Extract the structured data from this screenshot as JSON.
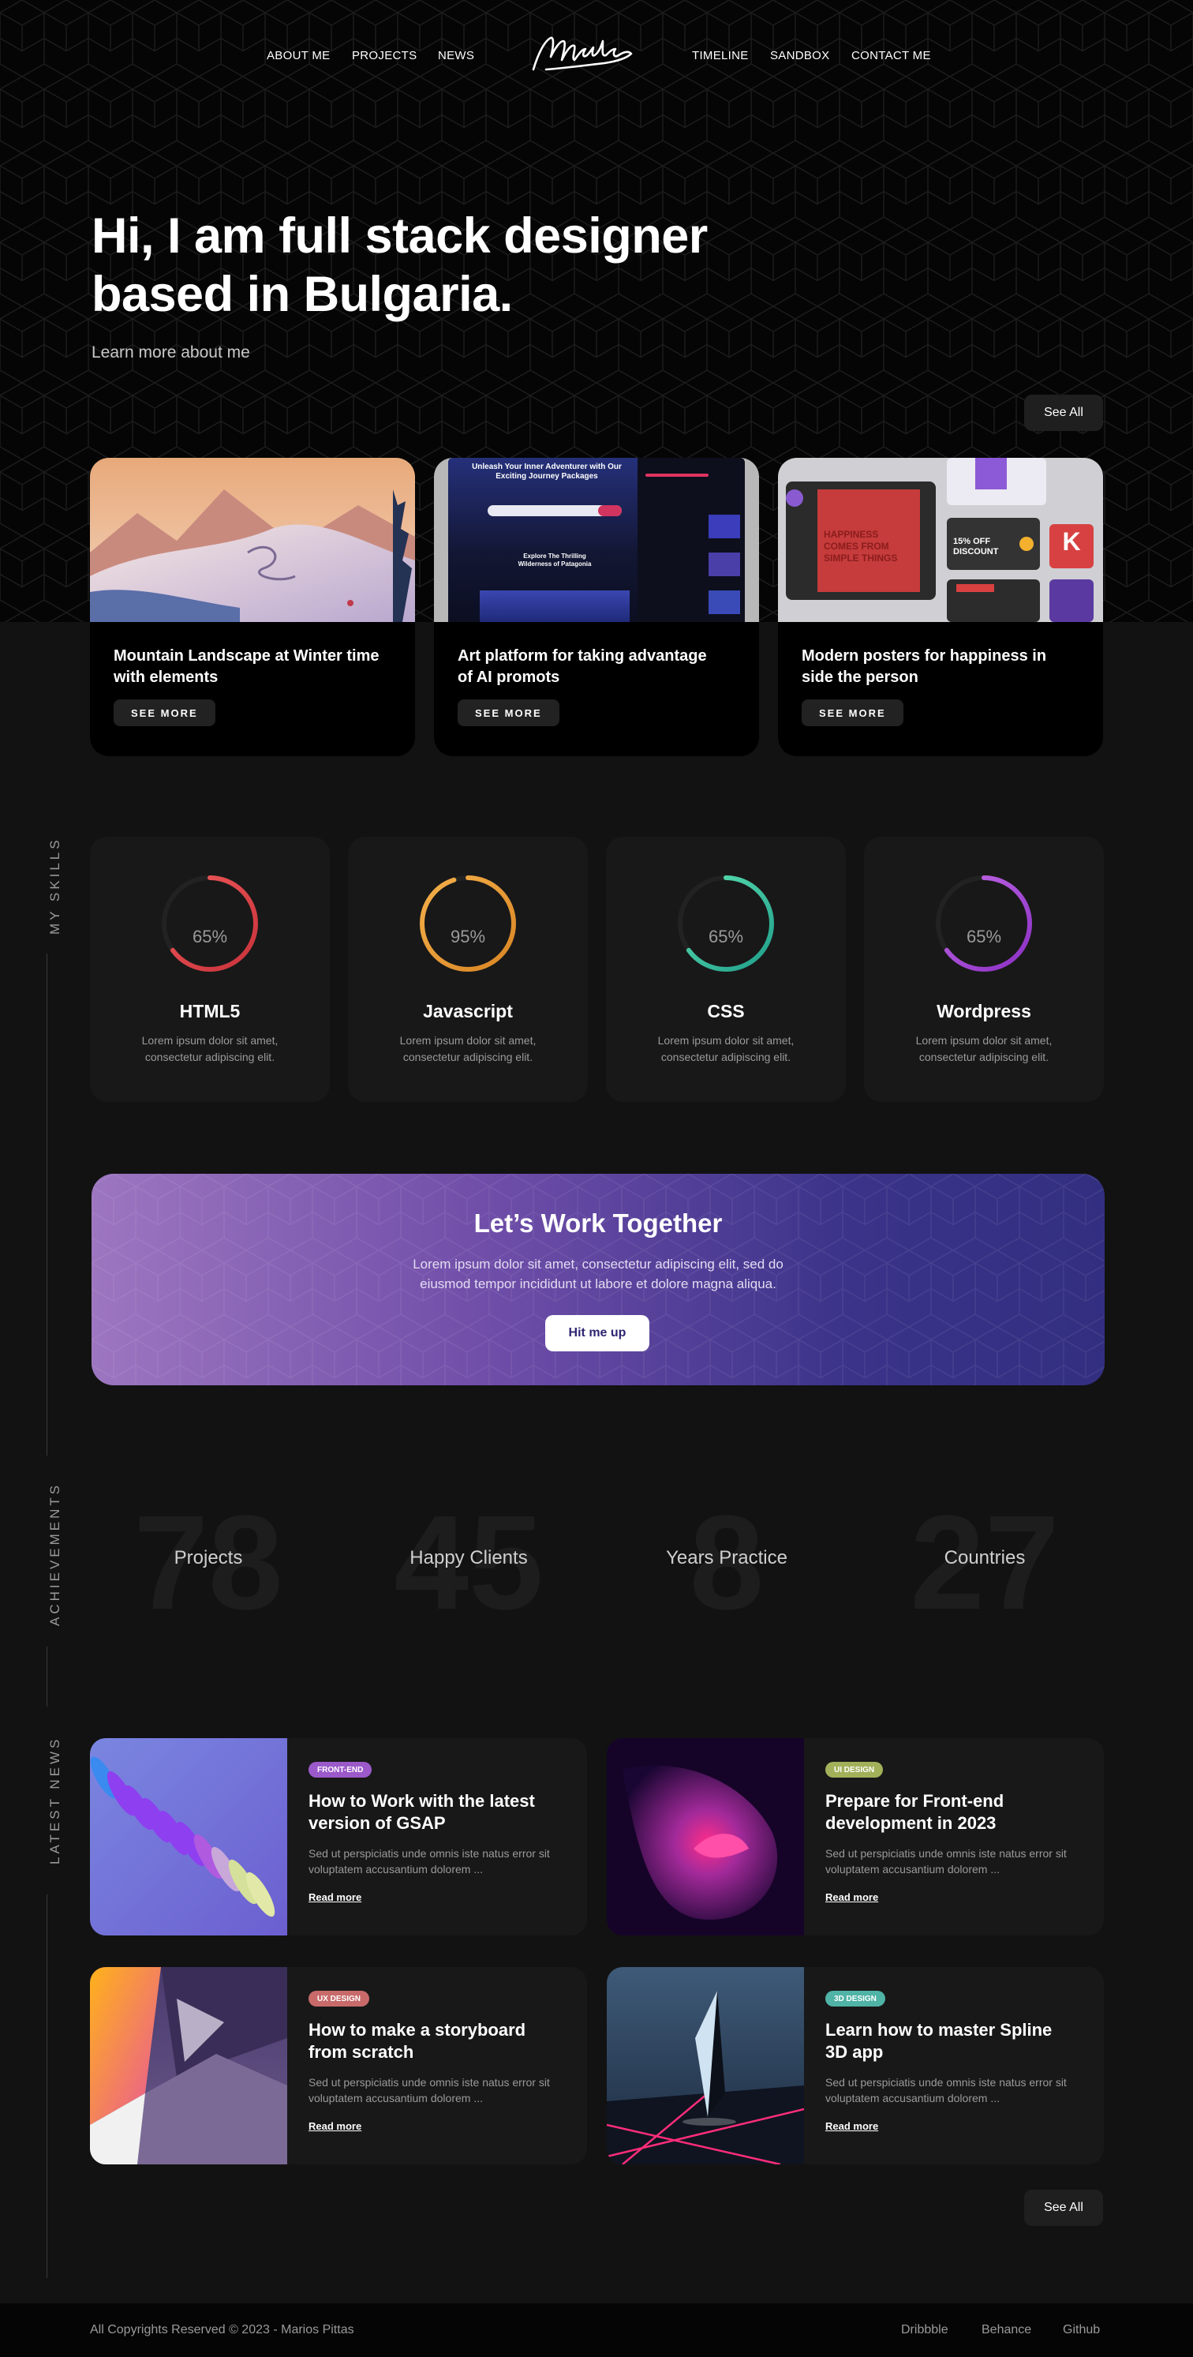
{
  "nav": {
    "left": [
      "ABOUT ME",
      "PROJECTS",
      "NEWS"
    ],
    "right": [
      "TIMELINE",
      "SANDBOX",
      "CONTACT ME"
    ]
  },
  "hero": {
    "title": "Hi, I am full stack designer based in Bulgaria.",
    "link": "Learn more about me",
    "see_all": "See All"
  },
  "projects": [
    {
      "title": "Mountain Landscape at Winter time with elements",
      "button": "SEE MORE"
    },
    {
      "title": "Art platform for taking advantage of AI promots",
      "button": "SEE MORE",
      "thumb_heading": "Unleash Your Inner Adventurer with Our Exciting Journey Packages",
      "thumb_sub": "Explore The Thrilling Wilderness of Patagonia"
    },
    {
      "title": "Modern posters for happiness in side the person",
      "button": "SEE MORE",
      "thumb_poster": "HAPPINESS COMES FROM SIMPLE THINGS",
      "thumb_discount": "15% OFF DISCOUNT",
      "thumb_k": "K"
    }
  ],
  "side_labels": {
    "skills": "MY SKILLS",
    "achievements": "ACHIEVEMENTS",
    "news": "LATEST NEWS"
  },
  "skills": [
    {
      "name": "HTML5",
      "percent_label": "65%",
      "percent": 65,
      "desc": "Lorem ipsum dolor sit amet, consectetur adipiscing elit.",
      "color_start": "#c8323a",
      "color_end": "#ee5a5a"
    },
    {
      "name": "Javascript",
      "percent_label": "95%",
      "percent": 95,
      "desc": "Lorem ipsum dolor sit amet, consectetur adipiscing elit.",
      "color_start": "#d98524",
      "color_end": "#f4b04a"
    },
    {
      "name": "CSS",
      "percent_label": "65%",
      "percent": 65,
      "desc": "Lorem ipsum dolor sit amet, consectetur adipiscing elit.",
      "color_start": "#1f9e8a",
      "color_end": "#5fe3b3"
    },
    {
      "name": "Wordpress",
      "percent_label": "65%",
      "percent": 65,
      "desc": "Lorem ipsum dolor sit amet, consectetur adipiscing elit.",
      "color_start": "#8a2fc4",
      "color_end": "#c36be6"
    }
  ],
  "cta": {
    "title": "Let’s Work Together",
    "text": "Lorem ipsum dolor sit amet, consectetur adipiscing elit, sed do eiusmod tempor incididunt ut labore et dolore magna aliqua.",
    "button": "Hit me up"
  },
  "achievements": [
    {
      "number": "78",
      "label": "Projects"
    },
    {
      "number": "45",
      "label": "Happy Clients"
    },
    {
      "number": "8",
      "label": "Years Practice"
    },
    {
      "number": "27",
      "label": "Countries"
    }
  ],
  "news": [
    {
      "tag": "FRONT-END",
      "tag_color": "#9b59c9",
      "title": "How to Work with the latest version of GSAP",
      "desc": "Sed ut perspiciatis unde omnis iste natus error sit voluptatem accusantium dolorem ...",
      "link": "Read more"
    },
    {
      "tag": "UI DESIGN",
      "tag_color": "#a3b05a",
      "title": "Prepare for Front-end development in 2023",
      "desc": "Sed ut perspiciatis unde omnis iste natus error sit voluptatem accusantium dolorem ...",
      "link": "Read more"
    },
    {
      "tag": "UX DESIGN",
      "tag_color": "#c86a6a",
      "title": "How to make a storyboard from scratch",
      "desc": "Sed ut perspiciatis unde omnis iste natus error sit voluptatem accusantium dolorem ...",
      "link": "Read more"
    },
    {
      "tag": "3D DESIGN",
      "tag_color": "#4fb3a6",
      "title": "Learn how to master Spline 3D app",
      "desc": "Sed ut perspiciatis unde omnis iste natus error sit voluptatem accusantium dolorem ...",
      "link": "Read more"
    }
  ],
  "news_see_all": "See All",
  "footer": {
    "copyright": "All Copyrights Reserved © 2023 - Marios Pittas",
    "links": [
      "Dribbble",
      "Behance",
      "Github"
    ]
  }
}
